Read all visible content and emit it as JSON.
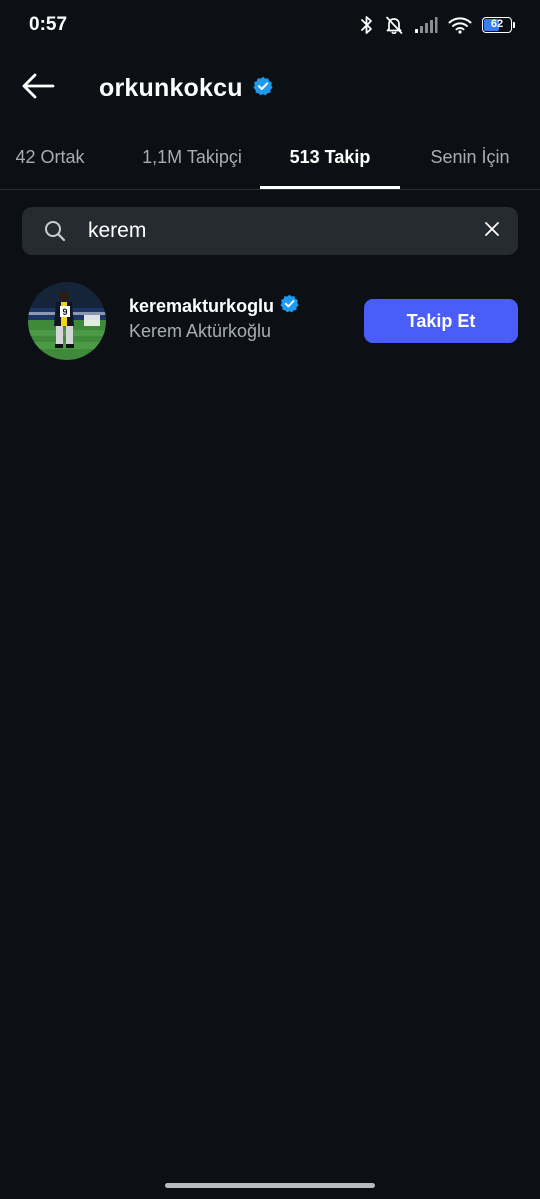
{
  "status_bar": {
    "time": "0:57",
    "battery_level": "62",
    "battery_fraction": 0.62,
    "icons": [
      "bluetooth-icon",
      "notifications-off-icon",
      "signal-icon",
      "wifi-icon",
      "battery-icon"
    ]
  },
  "header": {
    "title": "orkunkokcu",
    "verified": true,
    "back_icon": "arrow-left-icon"
  },
  "tabs": [
    {
      "label": "42 Ortak",
      "active": false
    },
    {
      "label": "1,1M Takipçi",
      "active": false
    },
    {
      "label": "513 Takip",
      "active": true
    },
    {
      "label": "Senin İçin",
      "active": false
    }
  ],
  "search": {
    "value": "kerem",
    "icon": "search-icon",
    "clear_icon": "close-icon"
  },
  "results": [
    {
      "username": "keremakturkoglu",
      "full_name": "Kerem Aktürkoğlu",
      "verified": true,
      "avatar_jersey_number": "9",
      "follow_label": "Takip Et"
    }
  ],
  "colors": {
    "background": "#0c1014",
    "search_bg": "#262a31",
    "accent_button": "#4a5df9",
    "verified_badge": "#1d9bf0",
    "secondary_text": "#a8adb3"
  }
}
